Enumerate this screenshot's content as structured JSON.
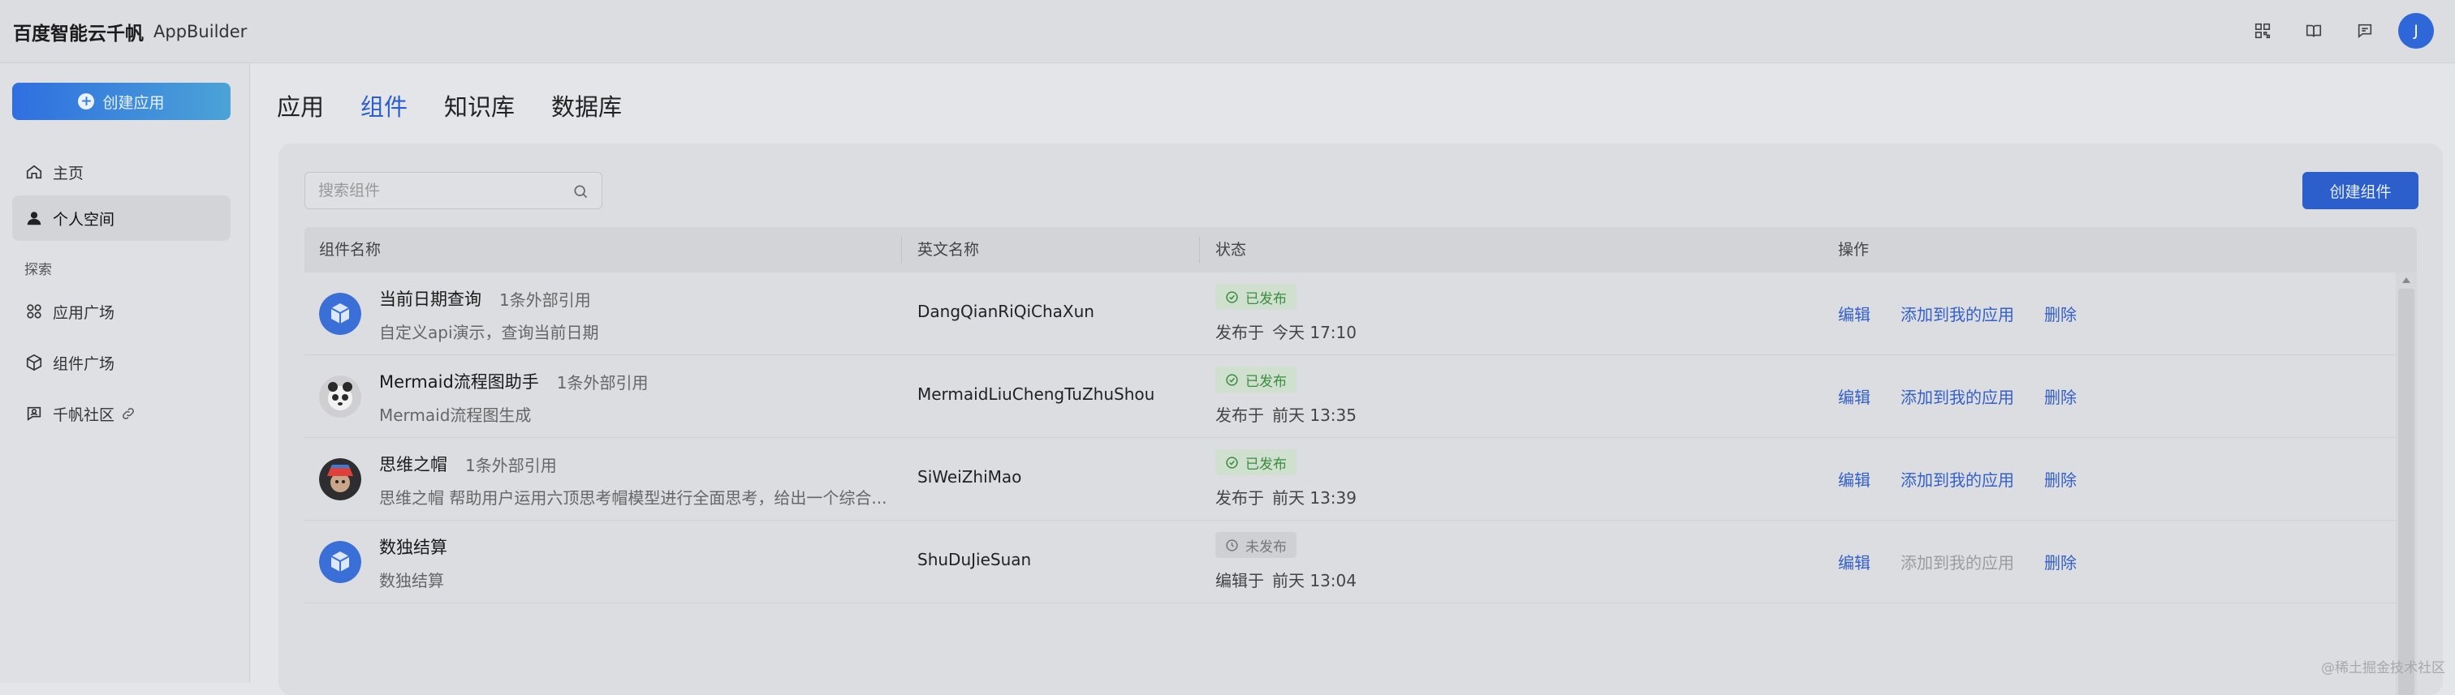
{
  "header": {
    "logo": "百度智能云千帆",
    "product": "AppBuilder",
    "icons": [
      "qr-grid-icon",
      "book-icon",
      "message-icon"
    ],
    "user_initial": "J"
  },
  "sidebar": {
    "create_button": "创建应用",
    "items": [
      {
        "label": "主页",
        "icon": "home-icon"
      },
      {
        "label": "个人空间",
        "icon": "user-icon",
        "active": true
      }
    ],
    "section_label": "探索",
    "explore_items": [
      {
        "label": "应用广场",
        "icon": "apps-icon"
      },
      {
        "label": "组件广场",
        "icon": "cube-icon"
      },
      {
        "label": "千帆社区",
        "icon": "community-icon"
      }
    ]
  },
  "tabs": [
    {
      "label": "应用"
    },
    {
      "label": "组件",
      "active": true
    },
    {
      "label": "知识库"
    },
    {
      "label": "数据库"
    }
  ],
  "search": {
    "placeholder": "搜索组件"
  },
  "create_component_button": "创建组件",
  "table": {
    "headers": [
      "组件名称",
      "英文名称",
      "状态",
      "操作"
    ],
    "rows": [
      {
        "name": "当前日期查询",
        "refs": "1条外部引用",
        "desc": "自定义api演示，查询当前日期",
        "en_name": "DangQianRiQiChaXun",
        "status": "已发布",
        "time_label": "发布于",
        "time": "今天 17:10",
        "avatar": "cube-avatar"
      },
      {
        "name": "Mermaid流程图助手",
        "refs": "1条外部引用",
        "desc": "Mermaid流程图生成",
        "en_name": "MermaidLiuChengTuZhuShou",
        "status": "已发布",
        "time_label": "发布于",
        "time": "前天 13:35",
        "avatar": "mermaid-avatar"
      },
      {
        "name": "思维之帽",
        "refs": "1条外部引用",
        "desc": "思维之帽 帮助用户运用六顶思考帽模型进行全面思考，给出一个综合...",
        "en_name": "SiWeiZhiMao",
        "status": "已发布",
        "time_label": "发布于",
        "time": "前天 13:39",
        "avatar": "hat-avatar"
      },
      {
        "name": "数独结算",
        "refs": "",
        "desc": "数独结算",
        "en_name": "ShuDuJieSuan",
        "status": "未发布",
        "time_label": "编辑于",
        "time": "前天 13:04",
        "avatar": "cube-avatar"
      }
    ],
    "actions": {
      "edit": "编辑",
      "add": "添加到我的应用",
      "delete": "删除"
    }
  },
  "watermark": "@稀土掘金技术社区",
  "colors": {
    "accent": "#2b5fcf",
    "published": "#3c8d3f",
    "unpublished": "#777777"
  }
}
